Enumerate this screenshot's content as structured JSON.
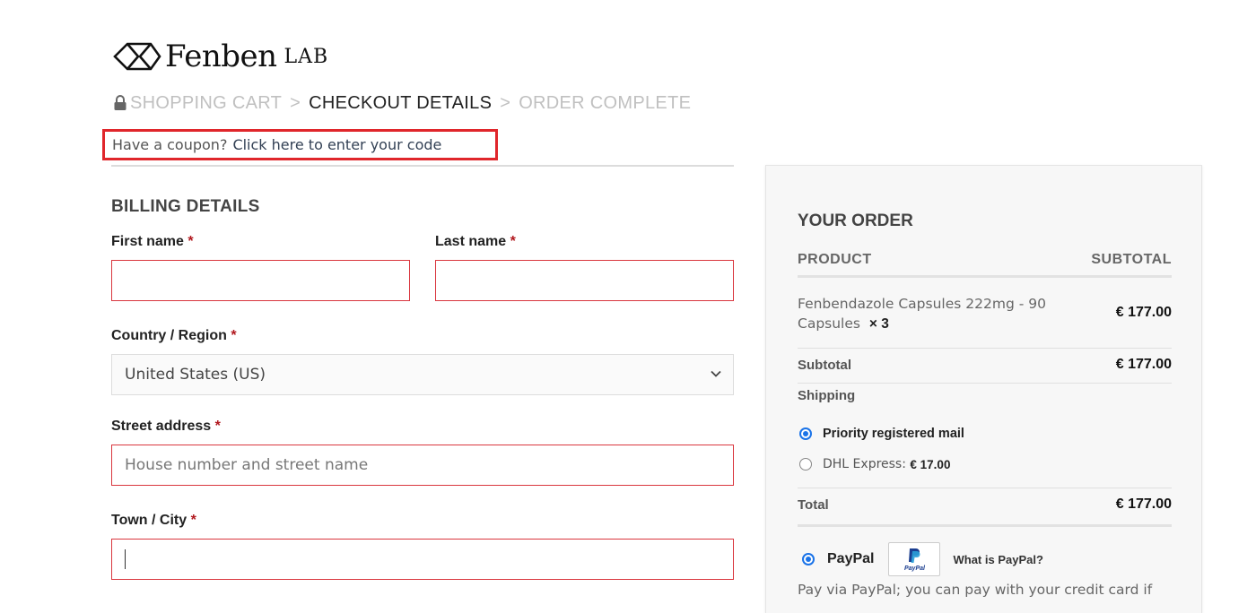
{
  "brand": {
    "name": "Fenben",
    "suffix": "LAB"
  },
  "breadcrumb": {
    "step1": "SHOPPING CART",
    "step2": "CHECKOUT DETAILS",
    "step3": "ORDER COMPLETE",
    "separator": ">"
  },
  "coupon": {
    "prompt": "Have a coupon?",
    "link": "Click here to enter your code"
  },
  "billing": {
    "title": "BILLING DETAILS",
    "first_name_label": "First name",
    "last_name_label": "Last name",
    "country_label": "Country / Region",
    "country_value": "United States (US)",
    "street_label": "Street address",
    "street_placeholder": "House number and street name",
    "city_label": "Town / City",
    "required_mark": "*"
  },
  "order": {
    "title": "YOUR ORDER",
    "col_product": "PRODUCT",
    "col_subtotal": "SUBTOTAL",
    "product_name": "Fenbendazole Capsules 222mg - 90 Capsules",
    "product_qty": "× 3",
    "product_price": "€ 177.00",
    "subtotal_label": "Subtotal",
    "subtotal_value": "€ 177.00",
    "shipping_label": "Shipping",
    "shipping_option1": "Priority registered mail",
    "shipping_option2": "DHL Express:",
    "shipping_option2_price": "€ 17.00",
    "total_label": "Total",
    "total_value": "€ 177.00",
    "payment_label": "PayPal",
    "paypal_logo_text": "PayPal",
    "what_is_paypal": "What is PayPal?",
    "payment_desc": "Pay via PayPal; you can pay with your credit card if"
  },
  "colors": {
    "required": "#b1181e",
    "field_border": "#d9363e",
    "highlight_box": "#e0262b",
    "radio": "#1a73e8"
  },
  "icons": {
    "logo": "diamond-logo-icon",
    "lock": "lock-icon",
    "chevron": "chevron-down-icon",
    "paypal": "paypal-icon"
  }
}
